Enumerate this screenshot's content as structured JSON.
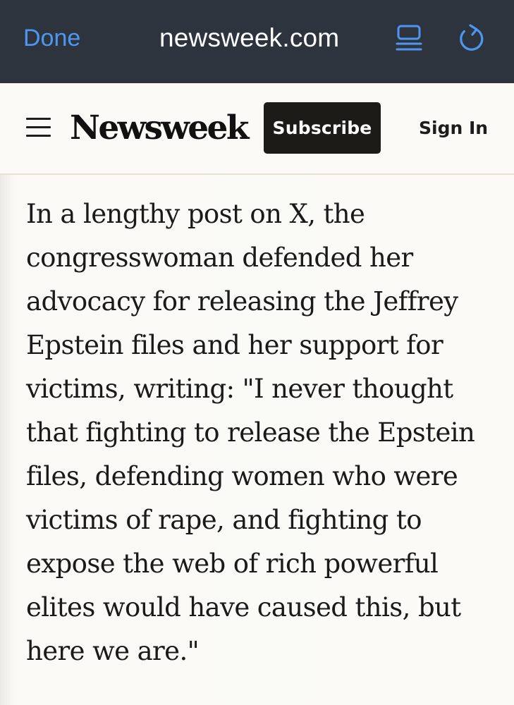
{
  "browser": {
    "done_label": "Done",
    "url": "newsweek.com",
    "reader_icon": "reader-mode-icon",
    "reload_icon": "reload-icon",
    "accent_color": "#4d97f0",
    "bar_color": "#2e343e"
  },
  "header": {
    "menu_icon": "hamburger-menu-icon",
    "logo_text": "Newsweek",
    "subscribe_label": "Subscribe",
    "signin_label": "Sign In"
  },
  "article": {
    "paragraph": "In a lengthy post on X, the congresswoman defended her advocacy for releasing the Jeffrey Epstein files and her support for victims, writing: \"I never thought that fighting to release the Epstein files, defending women who were victims of rape, and fighting to expose the web of rich powerful elites would have caused this, but here we are.\""
  }
}
